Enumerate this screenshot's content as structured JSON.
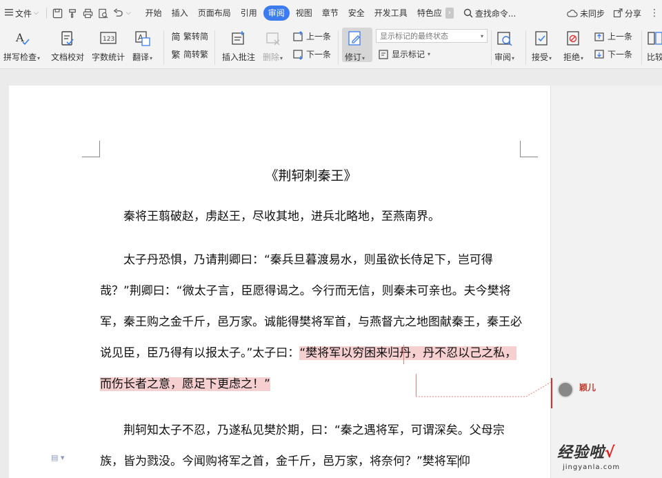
{
  "menubar": {
    "file_label": "文件",
    "tabs": [
      "开始",
      "插入",
      "页面布局",
      "引用",
      "审阅",
      "视图",
      "章节",
      "安全",
      "开发工具",
      "特色应"
    ],
    "active_tab": "审阅",
    "search_label": "查找命令...",
    "sync_label": "未同步",
    "share_label": "分享"
  },
  "ribbon": {
    "spell_check": "拼写检查",
    "doc_proof": "文档校对",
    "word_count": "字数统计",
    "translate": "翻译",
    "trad_to_simp": "繁转简",
    "simp_to_trad": "简转繁",
    "insert_comment": "插入批注",
    "delete": "删除",
    "prev_comment": "上一条",
    "next_comment": "下一条",
    "revise": "修订",
    "display_state": "显示标记的最终状态",
    "show_markup": "显示标记",
    "review": "审阅",
    "accept": "接受",
    "reject": "拒绝",
    "prev_change": "上一条",
    "next_change": "下一条",
    "compare": "比较"
  },
  "document": {
    "title": "《荆轲刺秦王》",
    "p1": "秦将王翦破赵，虏赵王，尽收其地，进兵北略地，至燕南界。",
    "p2_before": "太子丹恐惧，乃请荆卿曰：“秦兵旦暮渡易水，则虽欲长侍足下，岂可得哉？”荆卿曰：“微太子言，臣愿得谒之。今行而无信，则秦未可亲也。夫今樊将军，秦王购之金千斤，邑万家。诚能得樊将军首，与燕督亢之地图献秦王，秦王必说见臣，臣乃得有以报太子。”太子曰：",
    "p2_highlight": "“樊将军以穷困来归丹，丹不忍以己之私，而伤长者之意，愿足下更虑之！”",
    "p3_before": "荆轲知太子不忍，乃遂私见樊於期，曰：“秦之遇将军，可谓深矣。父母宗族，皆为戮没。今闻购将军之首，金千斤，邑万家，将奈何？”樊将军",
    "p3_after": "仰"
  },
  "comment": {
    "author": "颖儿"
  },
  "watermark": {
    "main": "经验啦",
    "check": "√",
    "sub": "jingyanla.com"
  },
  "colors": {
    "active_tab": "#3b7cf0",
    "highlight": "#f6cfd1",
    "comment_line": "#f07a7a",
    "comment_author": "#c0392b"
  }
}
